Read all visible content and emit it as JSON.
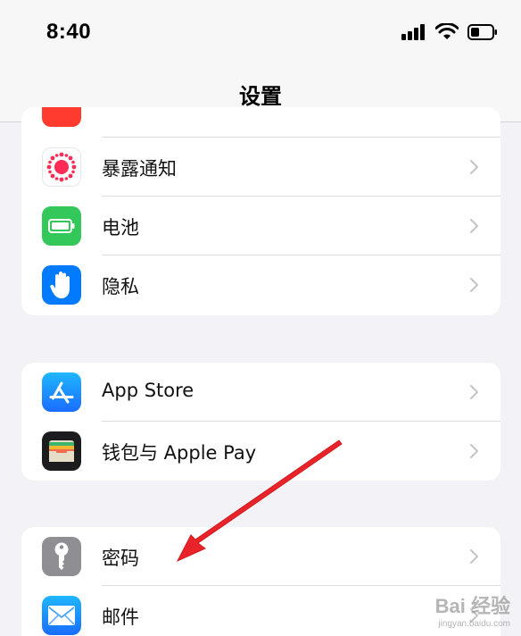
{
  "status_bar": {
    "time": "8:40",
    "icons": [
      "cellular-signal-icon",
      "wifi-icon",
      "battery-icon"
    ]
  },
  "nav": {
    "title": "设置"
  },
  "groups": [
    {
      "items": [
        {
          "label": "暴露通知",
          "icon": "exposure-notification-icon",
          "icon_color": "#ffffff"
        },
        {
          "label": "电池",
          "icon": "battery-icon",
          "icon_color": "#34c759"
        },
        {
          "label": "隐私",
          "icon": "hand-icon",
          "icon_color": "#007aff"
        }
      ]
    },
    {
      "items": [
        {
          "label": "App Store",
          "icon": "app-store-icon",
          "icon_color": "#1a8cff"
        },
        {
          "label": "钱包与 Apple Pay",
          "icon": "wallet-icon",
          "icon_color": "#1c1c1e"
        }
      ]
    },
    {
      "items": [
        {
          "label": "密码",
          "icon": "key-icon",
          "icon_color": "#8e8e93"
        },
        {
          "label": "邮件",
          "icon": "mail-icon",
          "icon_color": "#1a8cff"
        }
      ]
    }
  ],
  "annotation": {
    "arrow_color": "#e8232a"
  },
  "watermark": {
    "logo": "Bai 经验",
    "url": "jingyan.baidu.com"
  }
}
